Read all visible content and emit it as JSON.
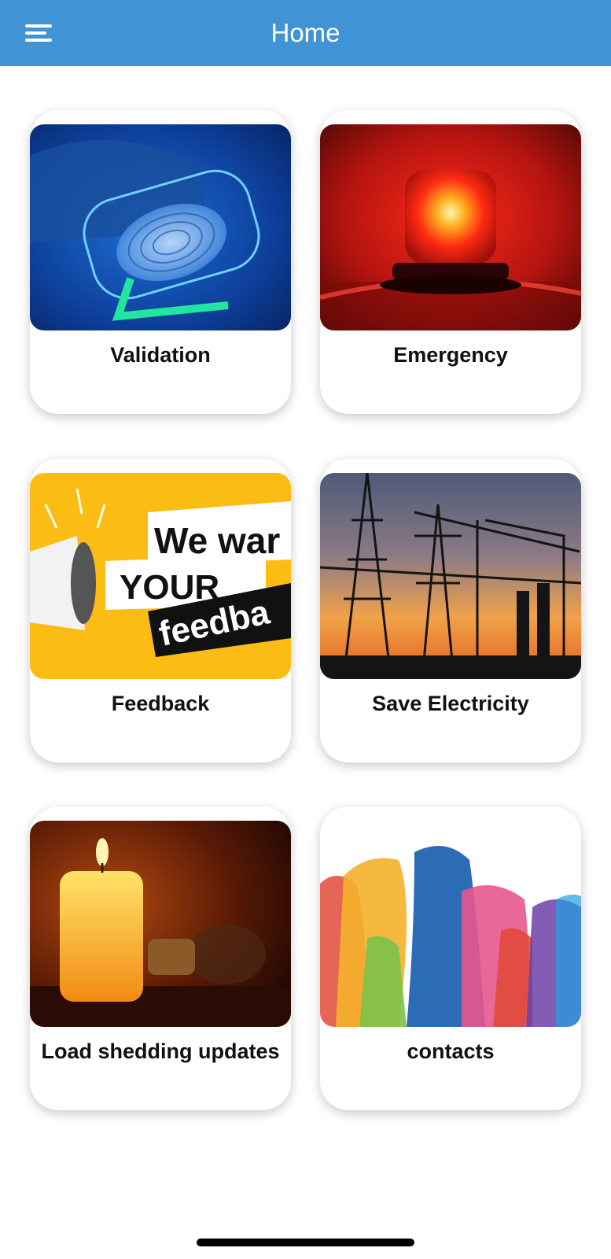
{
  "header": {
    "title": "Home",
    "menu_icon": "hamburger-menu-icon",
    "background_color": "#4093d4"
  },
  "tiles": [
    {
      "label": "Validation",
      "image": "fingerprint-scan-image"
    },
    {
      "label": "Emergency",
      "image": "red-alarm-siren-image"
    },
    {
      "label": "Feedback",
      "image": "we-want-your-feedback-banner-image",
      "image_text": [
        "We war",
        "YOUR",
        "feedba"
      ]
    },
    {
      "label": "Save Electricity",
      "image": "power-lines-sunset-image"
    },
    {
      "label": "Load shedding updates",
      "image": "candle-and-lightbulb-image"
    },
    {
      "label": "contacts",
      "image": "colorful-people-silhouettes-image"
    }
  ]
}
